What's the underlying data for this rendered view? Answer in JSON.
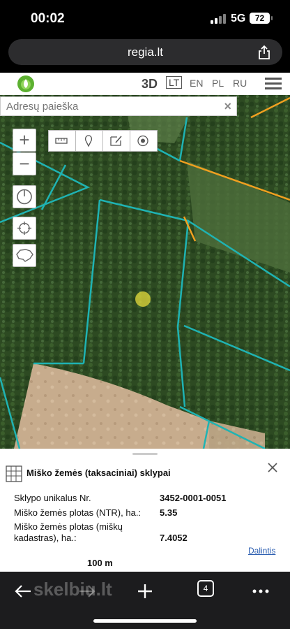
{
  "status_bar": {
    "time": "00:02",
    "network": "5G",
    "battery": "72"
  },
  "browser": {
    "url": "regia.lt"
  },
  "app_header": {
    "btn_3d": "3D",
    "languages": [
      "LT",
      "EN",
      "PL",
      "RU"
    ],
    "active_language": "LT"
  },
  "search": {
    "placeholder": "Adresų paieška",
    "clear_label": "×"
  },
  "map_controls": {
    "zoom_in": "+",
    "zoom_out": "−"
  },
  "panel": {
    "title": "Miško žemės (taksaciniai) sklypai",
    "rows": [
      {
        "label": "Sklypo unikalus Nr.",
        "value": "3452-0001-0051"
      },
      {
        "label": "Miško žemės plotas (NTR), ha.:",
        "value": "5.35"
      },
      {
        "label_line1": "Miško žemės plotas (miškų",
        "label_line2": "kadastras), ha.:",
        "value": "7.4052"
      }
    ],
    "share": "Dalintis",
    "scale": "100 m"
  },
  "toolbar": {
    "tab_count": "4",
    "watermark": "skelbiu.lt"
  },
  "colors": {
    "parcel_border": "#1fb3b3",
    "highlight_border": "#f0a020",
    "link": "#2a5db0"
  }
}
